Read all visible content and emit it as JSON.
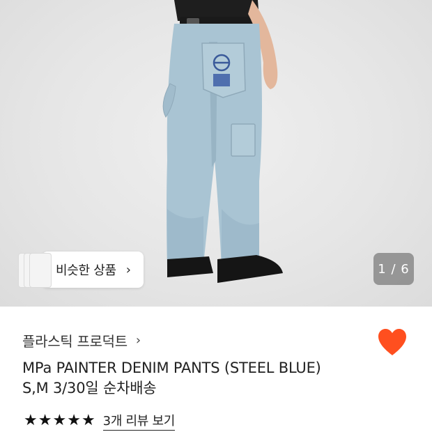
{
  "gallery": {
    "similar_label": "비슷한 상품",
    "similar_chevron": "›",
    "counter": "1 / 6"
  },
  "product": {
    "brand": "플라스틱 프로덕트",
    "brand_chevron": "›",
    "title_line1": "MPa PAINTER DENIM PANTS (STEEL BLUE)",
    "title_line2": "S,M 3/30일 순차배송",
    "rating_stars": 5,
    "review_link": "3개 리뷰 보기"
  },
  "colors": {
    "heart": "#ff4f1f",
    "denim": "#a9c4d3",
    "background": "#e8e8e8"
  },
  "icons": {
    "heart": "heart-icon",
    "star": "star-icon",
    "chevron": "chevron-right-icon"
  }
}
